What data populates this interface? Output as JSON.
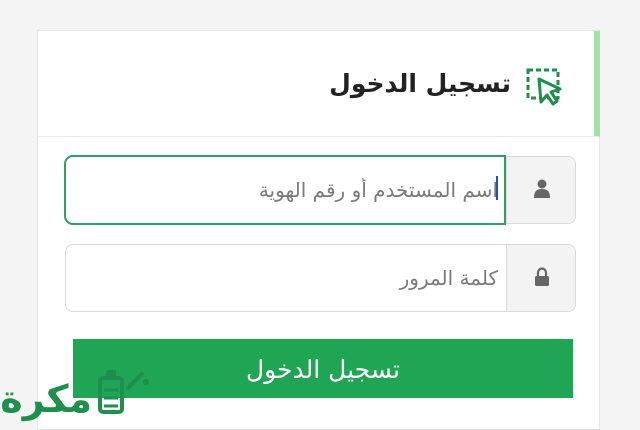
{
  "header": {
    "title": "تسجيل الدخول",
    "icon": "dashed-select-cursor-icon"
  },
  "form": {
    "username": {
      "value": "",
      "placeholder": "اسم المستخدم أو رقم الهوية",
      "icon": "user-icon"
    },
    "password": {
      "value": "",
      "placeholder": "كلمة المرور",
      "icon": "lock-icon"
    },
    "submit_label": "تسجيل الدخول"
  },
  "watermark": {
    "text": "مكرة"
  },
  "colors": {
    "accent_green": "#20a554",
    "focus_border": "#2e9e6a",
    "side_accent": "#a3e1a4",
    "caret": "#1a4fd1"
  }
}
